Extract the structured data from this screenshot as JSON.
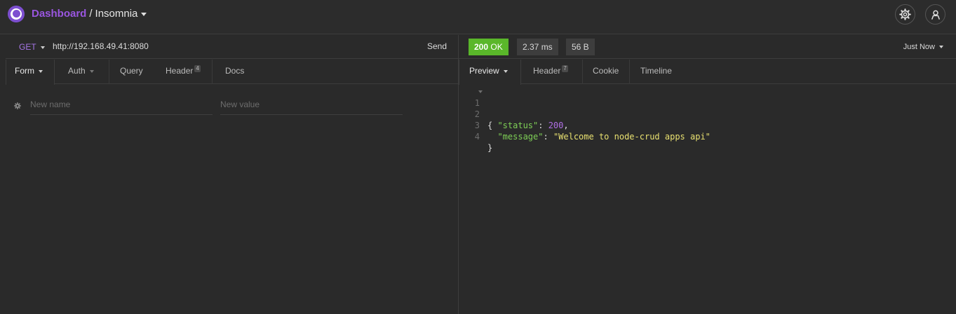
{
  "header": {
    "breadcrumb_link": "Dashboard",
    "breadcrumb_sep": "/",
    "workspace": "Insomnia",
    "icons": {
      "logo": "insomnia-logo",
      "settings": "gear-icon",
      "account": "user-icon"
    }
  },
  "request": {
    "method": "GET",
    "url": "http://192.168.49.41:8080",
    "send_label": "Send",
    "tabs": [
      {
        "label": "Form",
        "active": true
      },
      {
        "label": "Auth"
      },
      {
        "label": "Query"
      },
      {
        "label": "Header",
        "count": "4"
      },
      {
        "label": "Docs"
      }
    ],
    "form": {
      "name_placeholder": "New name",
      "value_placeholder": "New value"
    }
  },
  "response": {
    "status": "200",
    "status_text": "OK",
    "time": "2.37 ms",
    "size": "56 B",
    "history": "Just Now",
    "tabs": [
      {
        "label": "Preview",
        "active": true
      },
      {
        "label": "Header",
        "count": "7"
      },
      {
        "label": "Cookie"
      },
      {
        "label": "Timeline"
      }
    ],
    "body": {
      "line_numbers": [
        "1",
        "2",
        "3",
        "4"
      ],
      "open_brace": "{",
      "close_brace": "}",
      "status_key": "\"status\"",
      "status_value": "200",
      "message_key": "\"message\"",
      "message_value": "\"Welcome to node-crud apps api\""
    }
  },
  "colors": {
    "accent": "#9a56e0",
    "ok": "#5ab72a",
    "background": "#2a2a2a"
  }
}
